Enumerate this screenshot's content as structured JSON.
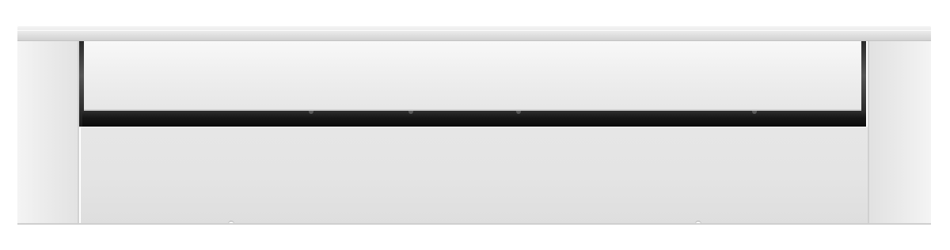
{
  "image": {
    "subject": "baseboard-heater",
    "colors": {
      "body": "#e4e4e4",
      "cap": "#ececec",
      "opening": "#111111",
      "background": "#ffffff"
    }
  }
}
